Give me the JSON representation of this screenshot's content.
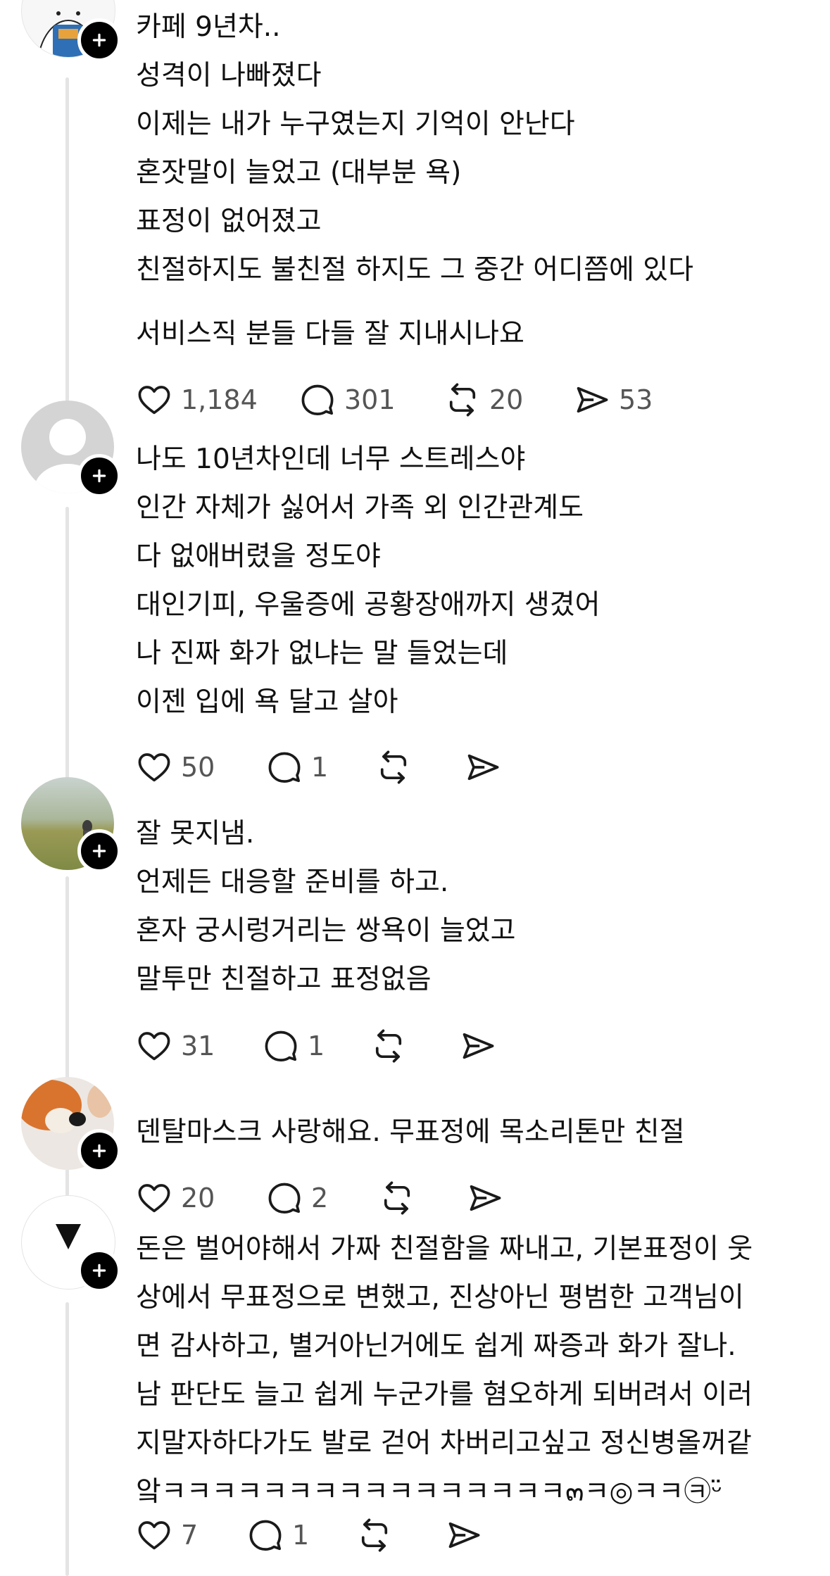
{
  "posts": [
    {
      "lines": [
        "카페 9년차..",
        "성격이 나빠졌다",
        "이제는 내가 누구였는지 기억이 안난다",
        "혼잣말이 늘었고 (대부분 욕)",
        "표정이 없어졌고",
        "친절하지도 불친절 하지도 그 중간 어디쯤에 있다"
      ],
      "lines2": [
        "서비스직 분들 다들 잘 지내시나요"
      ],
      "likes": "1,184",
      "comments": "301",
      "reposts": "20",
      "shares": "53"
    },
    {
      "lines": [
        "나도 10년차인데 너무 스트레스야",
        "인간 자체가 싫어서 가족 외 인간관계도",
        "다 없애버렸을 정도야",
        "대인기피, 우울증에 공황장애까지 생겼어",
        "나 진짜 화가 없냐는 말 들었는데",
        "이젠 입에 욕 달고 살아"
      ],
      "likes": "50",
      "comments": "1",
      "reposts": "",
      "shares": ""
    },
    {
      "lines": [
        "잘 못지냄.",
        "언제든 대응할 준비를 하고.",
        "혼자 궁시렁거리는 쌍욕이 늘었고",
        "말투만 친절하고  표정없음"
      ],
      "likes": "31",
      "comments": "1",
      "reposts": "",
      "shares": ""
    },
    {
      "lines": [
        "덴탈마스크 사랑해요. 무표정에 목소리톤만 친절"
      ],
      "likes": "20",
      "comments": "2",
      "reposts": "",
      "shares": ""
    },
    {
      "lines": [
        "돈은 벌어야해서 가짜 친절함을 짜내고, 기본표정이 웃",
        "상에서 무표정으로 변했고, 진상아닌 평범한 고객님이",
        "면 감사하고, 별거아닌거에도 쉽게 짜증과 화가 잘나.",
        "남 판단도 늘고 쉽게 누군가를 혐오하게 되버려서 이러",
        "지말자하다가도 발로 걷어 차버리고싶고 정신병올꺼같",
        "앜ㅋㅋㅋㅋㅋㅋㅋㅋㅋㅋㅋㅋㅋㅋㅋㅋ๓ㅋ◎ㅋㅋ㉪ᵕ̈"
      ],
      "likes": "7",
      "comments": "1",
      "reposts": "",
      "shares": ""
    }
  ],
  "icons": [
    "heart-icon",
    "comment-icon",
    "repost-icon",
    "share-icon",
    "follow-plus-icon"
  ]
}
